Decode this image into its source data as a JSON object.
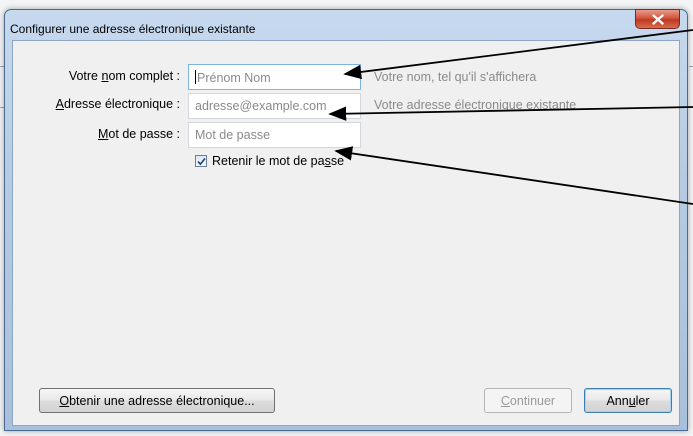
{
  "window": {
    "title": "Configurer une adresse électronique existante",
    "close_symbol": "x"
  },
  "form": {
    "name_label_pre": "Votre ",
    "name_label_accel": "n",
    "name_label_post": "om complet :",
    "name_placeholder": "Prénom Nom",
    "name_hint": "Votre nom, tel qu'il s'affichera",
    "email_label_accel": "A",
    "email_label_post": "dresse électronique :",
    "email_placeholder": "adresse@example.com",
    "email_hint": "Votre adresse électronique existante",
    "password_label_accel": "M",
    "password_label_post": "ot de passe :",
    "password_placeholder": "Mot de passe",
    "remember_pre": "Retenir le mot de pa",
    "remember_accel": "s",
    "remember_post": "se",
    "remember_checked": true
  },
  "buttons": {
    "get_address_accel": "O",
    "get_address_post": "btenir une adresse électronique...",
    "continue_accel": "C",
    "continue_post": "ontinuer",
    "cancel_pre": "Ann",
    "cancel_accel": "u",
    "cancel_post": "ler"
  },
  "colors": {
    "accent": "#3c7fb1",
    "titlebar": "#b6cbe3",
    "close": "#c0381f"
  }
}
